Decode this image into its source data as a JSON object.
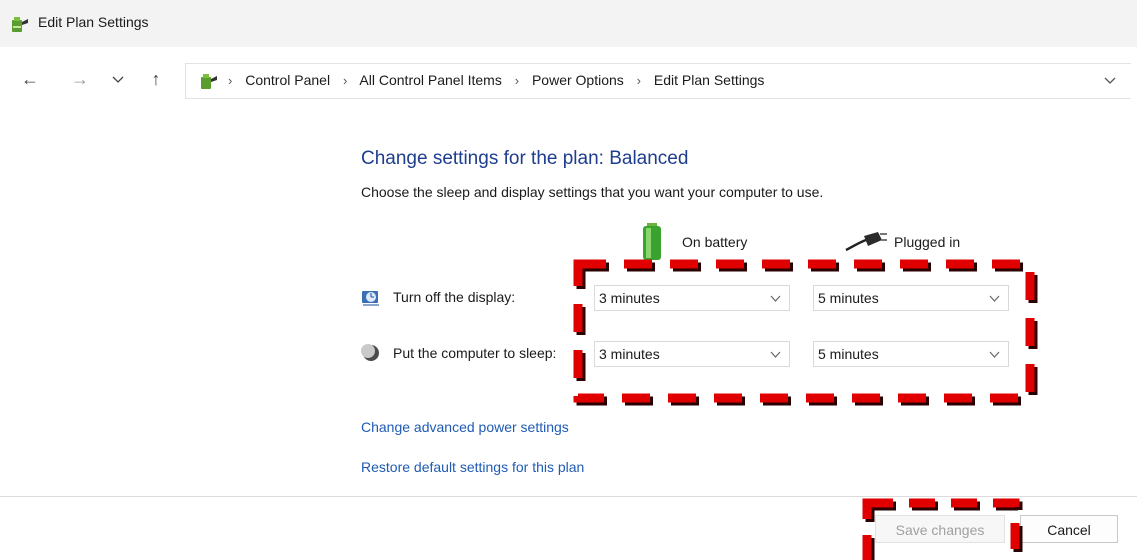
{
  "window": {
    "title": "Edit Plan Settings"
  },
  "breadcrumb": [
    "Control Panel",
    "All Control Panel Items",
    "Power Options",
    "Edit Plan Settings"
  ],
  "main": {
    "heading": "Change settings for the plan: Balanced",
    "description": "Choose the sleep and display settings that you want your computer to use.",
    "columns": {
      "battery": "On battery",
      "plugged": "Plugged in"
    },
    "rows": [
      {
        "label": "Turn off the display:",
        "battery": "3 minutes",
        "plugged": "5 minutes"
      },
      {
        "label": "Put the computer to sleep:",
        "battery": "3 minutes",
        "plugged": "5 minutes"
      }
    ],
    "links": {
      "advanced": "Change advanced power settings",
      "restore": "Restore default settings for this plan"
    }
  },
  "footer": {
    "save": "Save changes",
    "cancel": "Cancel"
  },
  "colors": {
    "heading": "#1e3d8f",
    "link": "#1f5bb5",
    "annotation": "#e00000"
  }
}
